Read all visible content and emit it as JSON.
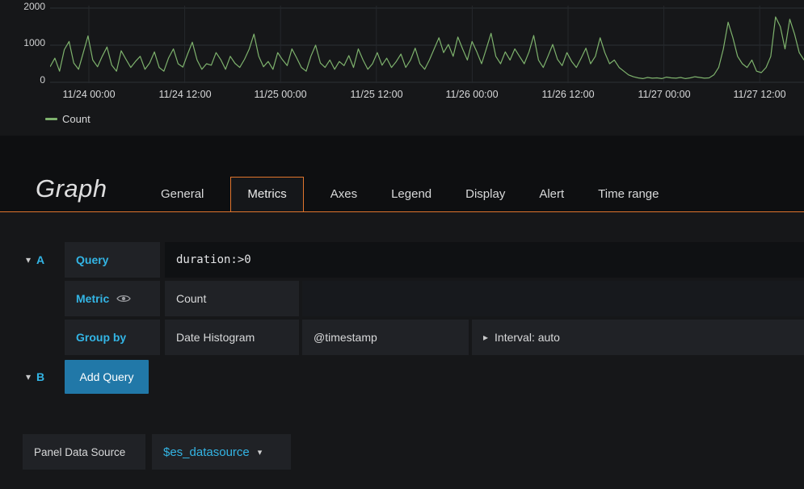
{
  "chart_data": {
    "type": "line",
    "title": "",
    "xlabel": "",
    "ylabel": "",
    "ylim": [
      0,
      2000
    ],
    "grid": true,
    "legend_position": "bottom-left",
    "y_ticks": [
      "2000",
      "1000",
      "0"
    ],
    "x_ticks": [
      "11/24 00:00",
      "11/24 12:00",
      "11/25 00:00",
      "11/25 12:00",
      "11/26 00:00",
      "11/26 12:00",
      "11/27 00:00",
      "11/27 12:00"
    ],
    "series": [
      {
        "name": "Count",
        "color": "#7eb26d",
        "values": [
          420,
          650,
          300,
          880,
          1100,
          520,
          350,
          800,
          1250,
          600,
          420,
          700,
          950,
          460,
          300,
          850,
          620,
          400,
          560,
          700,
          350,
          520,
          820,
          400,
          300,
          660,
          900,
          500,
          410,
          760,
          1080,
          600,
          350,
          500,
          460,
          800,
          610,
          350,
          700,
          510,
          400,
          620,
          900,
          1300,
          700,
          420,
          560,
          350,
          800,
          610,
          450,
          900,
          660,
          400,
          300,
          700,
          1000,
          520,
          400,
          600,
          350,
          560,
          450,
          720,
          400,
          900,
          600,
          350,
          500,
          800,
          460,
          650,
          400,
          560,
          760,
          400,
          600,
          920,
          500,
          350,
          600,
          900,
          1200,
          800,
          1020,
          700,
          1220,
          900,
          600,
          1100,
          820,
          500,
          900,
          1320,
          700,
          500,
          820,
          600,
          900,
          700,
          500,
          820,
          1260,
          600,
          400,
          700,
          1020,
          620,
          450,
          800,
          560,
          400,
          650,
          920,
          500,
          700,
          1200,
          800,
          500,
          600,
          400,
          300,
          200,
          150,
          120,
          100,
          130,
          110,
          120,
          100,
          140,
          120,
          110,
          130,
          100,
          120,
          150,
          130,
          110,
          120,
          200,
          400,
          900,
          1620,
          1200,
          700,
          500,
          400,
          600,
          300,
          260,
          400,
          700,
          1760,
          1500,
          900,
          1700,
          1300,
          800,
          600
        ]
      }
    ]
  },
  "editor": {
    "title": "Graph",
    "active_tab": "Metrics",
    "tabs": [
      {
        "label": "General"
      },
      {
        "label": "Metrics"
      },
      {
        "label": "Axes"
      },
      {
        "label": "Legend"
      },
      {
        "label": "Display"
      },
      {
        "label": "Alert"
      },
      {
        "label": "Time range"
      }
    ],
    "query_row": {
      "letter": "A",
      "label": "Query",
      "value": "duration:>0"
    },
    "metric_row": {
      "label": "Metric",
      "value": "Count"
    },
    "groupby_row": {
      "label": "Group by",
      "type": "Date Histogram",
      "field": "@timestamp",
      "interval": "Interval: auto"
    },
    "add_row": {
      "letter": "B",
      "button_label": "Add Query"
    },
    "datasource_row": {
      "label": "Panel Data Source",
      "value": "$es_datasource"
    }
  },
  "icons": {
    "caret_down": "▾",
    "caret_right": "▸",
    "dropdown_caret": "▾"
  },
  "colors": {
    "accent_orange": "#e0752d",
    "link_blue": "#33b5e5",
    "series_green": "#7eb26d",
    "button_blue": "#2178a8"
  }
}
